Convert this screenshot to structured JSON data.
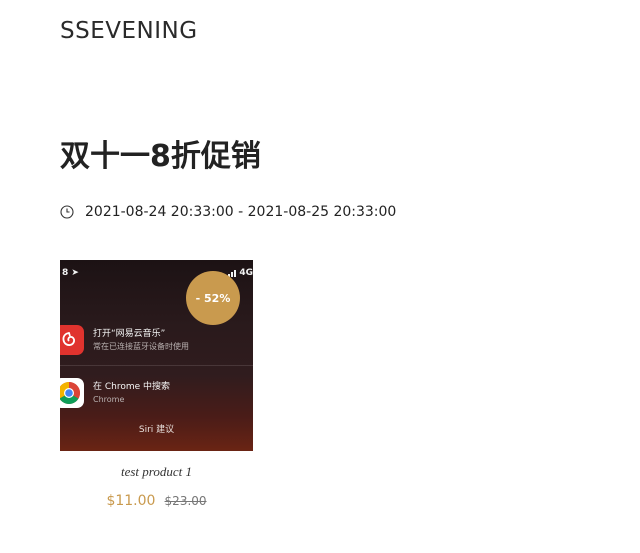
{
  "header": {
    "brand": "SSEVENING"
  },
  "sale": {
    "title": "双十一8折促销",
    "date_range": "2021-08-24 20:33:00 - 2021-08-25 20:33:00"
  },
  "product": {
    "name": "test product 1",
    "price_current": "$11.00",
    "price_original": "$23.00",
    "badge": "- 52%",
    "image": {
      "status_left": "8 ➤",
      "status_right": "4G",
      "row1_main": "打开“网易云音乐”",
      "row1_sub": "常在已连接蓝牙设备时使用",
      "row2_main": "在 Chrome 中搜索",
      "row2_sub": "Chrome",
      "footer": "Siri 建议"
    }
  },
  "icons": {
    "clock": "clock-icon",
    "netease": "netease-music-icon",
    "chrome": "chrome-icon",
    "signal": "signal-bars-icon"
  },
  "colors": {
    "accent": "#c99a4e",
    "netease_red": "#e0332e"
  }
}
